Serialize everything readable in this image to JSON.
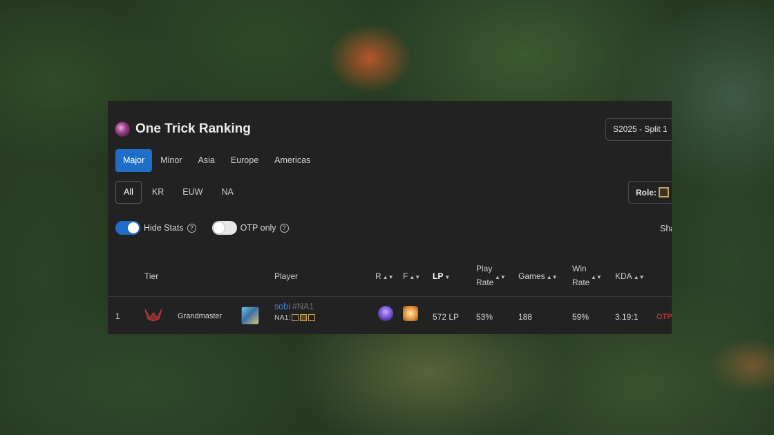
{
  "header": {
    "title": "One Trick Ranking",
    "season": "S2025 - Split 1"
  },
  "region_tabs": [
    "Major",
    "Minor",
    "Asia",
    "Europe",
    "Americas"
  ],
  "server_tabs": [
    "All",
    "KR",
    "EUW",
    "NA"
  ],
  "role_label": "Role:",
  "toggles": {
    "hide_stats": {
      "label": "Hide Stats",
      "on": true
    },
    "otp_only": {
      "label": "OTP only",
      "on": false
    },
    "help_glyph": "?"
  },
  "share_label": "Sha",
  "table": {
    "headers": {
      "tier": "Tier",
      "player": "Player",
      "r": "R",
      "f": "F",
      "lp": "LP",
      "play_rate_1": "Play",
      "play_rate_2": "Rate",
      "games": "Games",
      "win_rate_1": "Win",
      "win_rate_2": "Rate",
      "kda": "KDA"
    },
    "rows": [
      {
        "rank": "1",
        "tier": "Grandmaster",
        "name": "sobi",
        "tag": "#NA1",
        "server": "NA1:",
        "lp": "572 LP",
        "play_rate": "53%",
        "games": "188",
        "win_rate": "59%",
        "kda": "3.19:1",
        "badge": "OTP"
      }
    ]
  },
  "colors": {
    "accent": "#1f6fc8",
    "link": "#3f88d8",
    "otp": "#e23a3a",
    "panel": "#222223"
  }
}
